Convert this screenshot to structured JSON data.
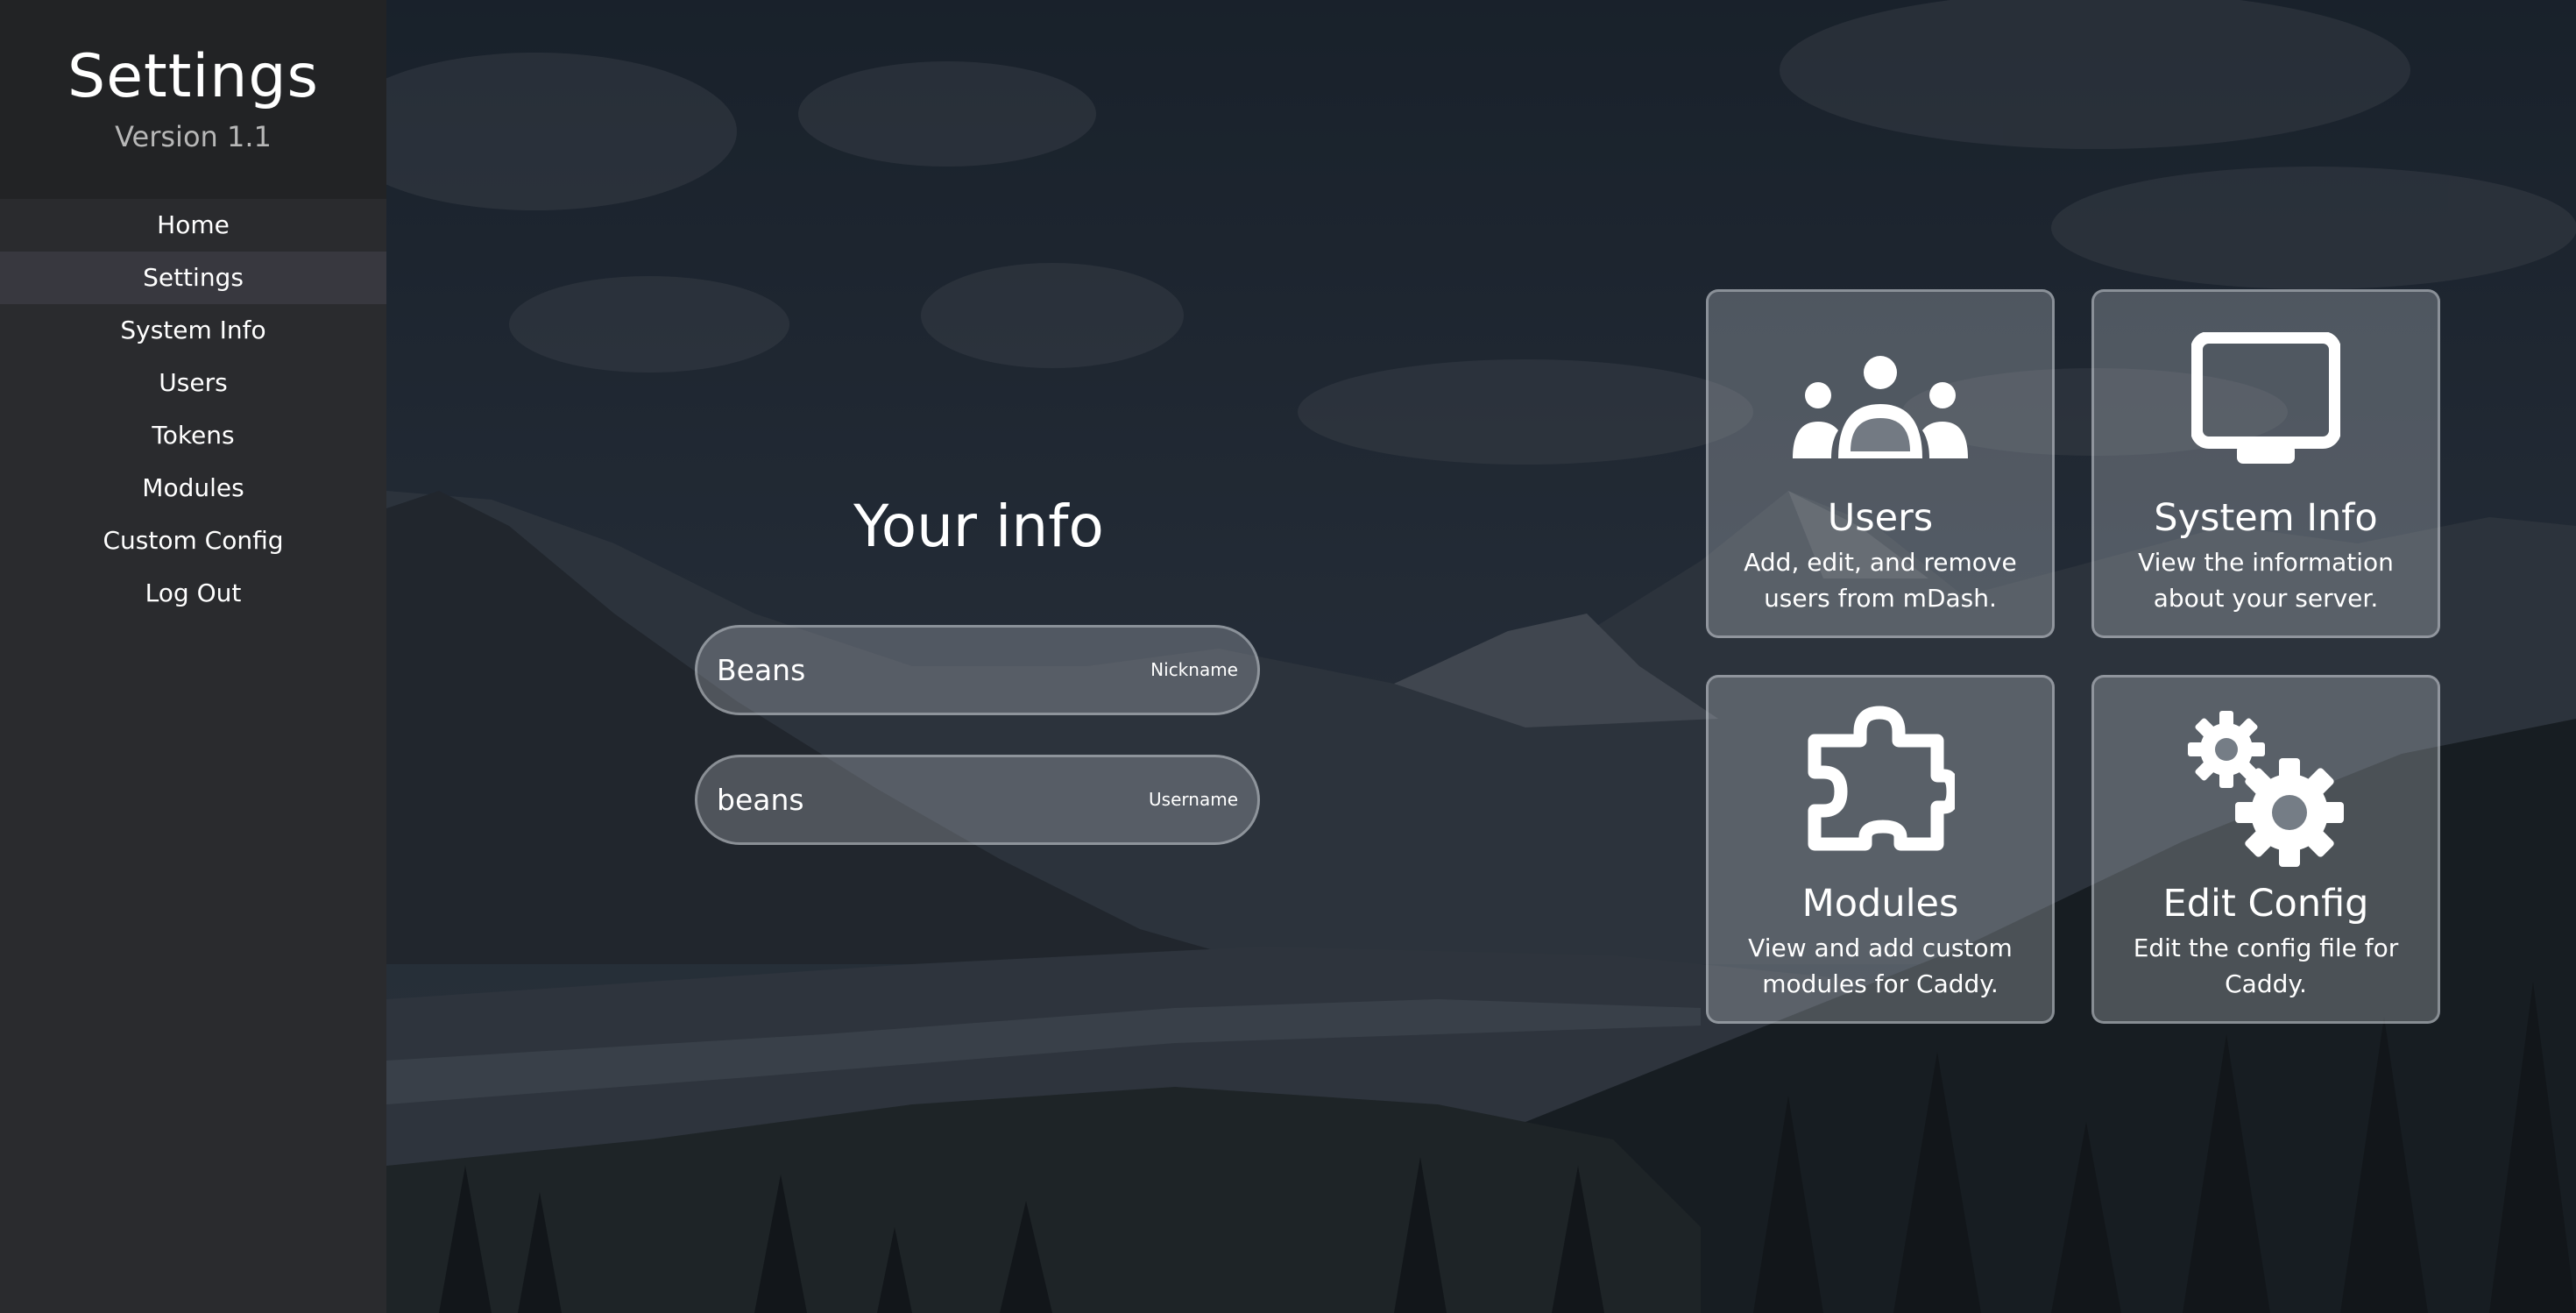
{
  "sidebar": {
    "title": "Settings",
    "version": "Version 1.1",
    "items": [
      {
        "label": "Home",
        "active": false
      },
      {
        "label": "Settings",
        "active": true
      },
      {
        "label": "System Info",
        "active": false
      },
      {
        "label": "Users",
        "active": false
      },
      {
        "label": "Tokens",
        "active": false
      },
      {
        "label": "Modules",
        "active": false
      },
      {
        "label": "Custom Config",
        "active": false
      },
      {
        "label": "Log Out",
        "active": false
      }
    ]
  },
  "info": {
    "title": "Your info",
    "nickname": {
      "value": "Beans",
      "label": "Nickname"
    },
    "username": {
      "value": "beans",
      "label": "Username"
    }
  },
  "cards": [
    {
      "title": "Users",
      "description": "Add, edit, and remove users from mDash.",
      "icon": "users-icon"
    },
    {
      "title": "System Info",
      "description": "View the information about your server.",
      "icon": "monitor-icon"
    },
    {
      "title": "Modules",
      "description": "View and add custom modules for Caddy.",
      "icon": "puzzle-icon"
    },
    {
      "title": "Edit Config",
      "description": "Edit the config file for Caddy.",
      "icon": "gears-icon"
    }
  ],
  "colors": {
    "sidebar_bg": "#2a2b2e",
    "sidebar_header_bg": "#222325",
    "active_item_bg": "#38383f"
  }
}
